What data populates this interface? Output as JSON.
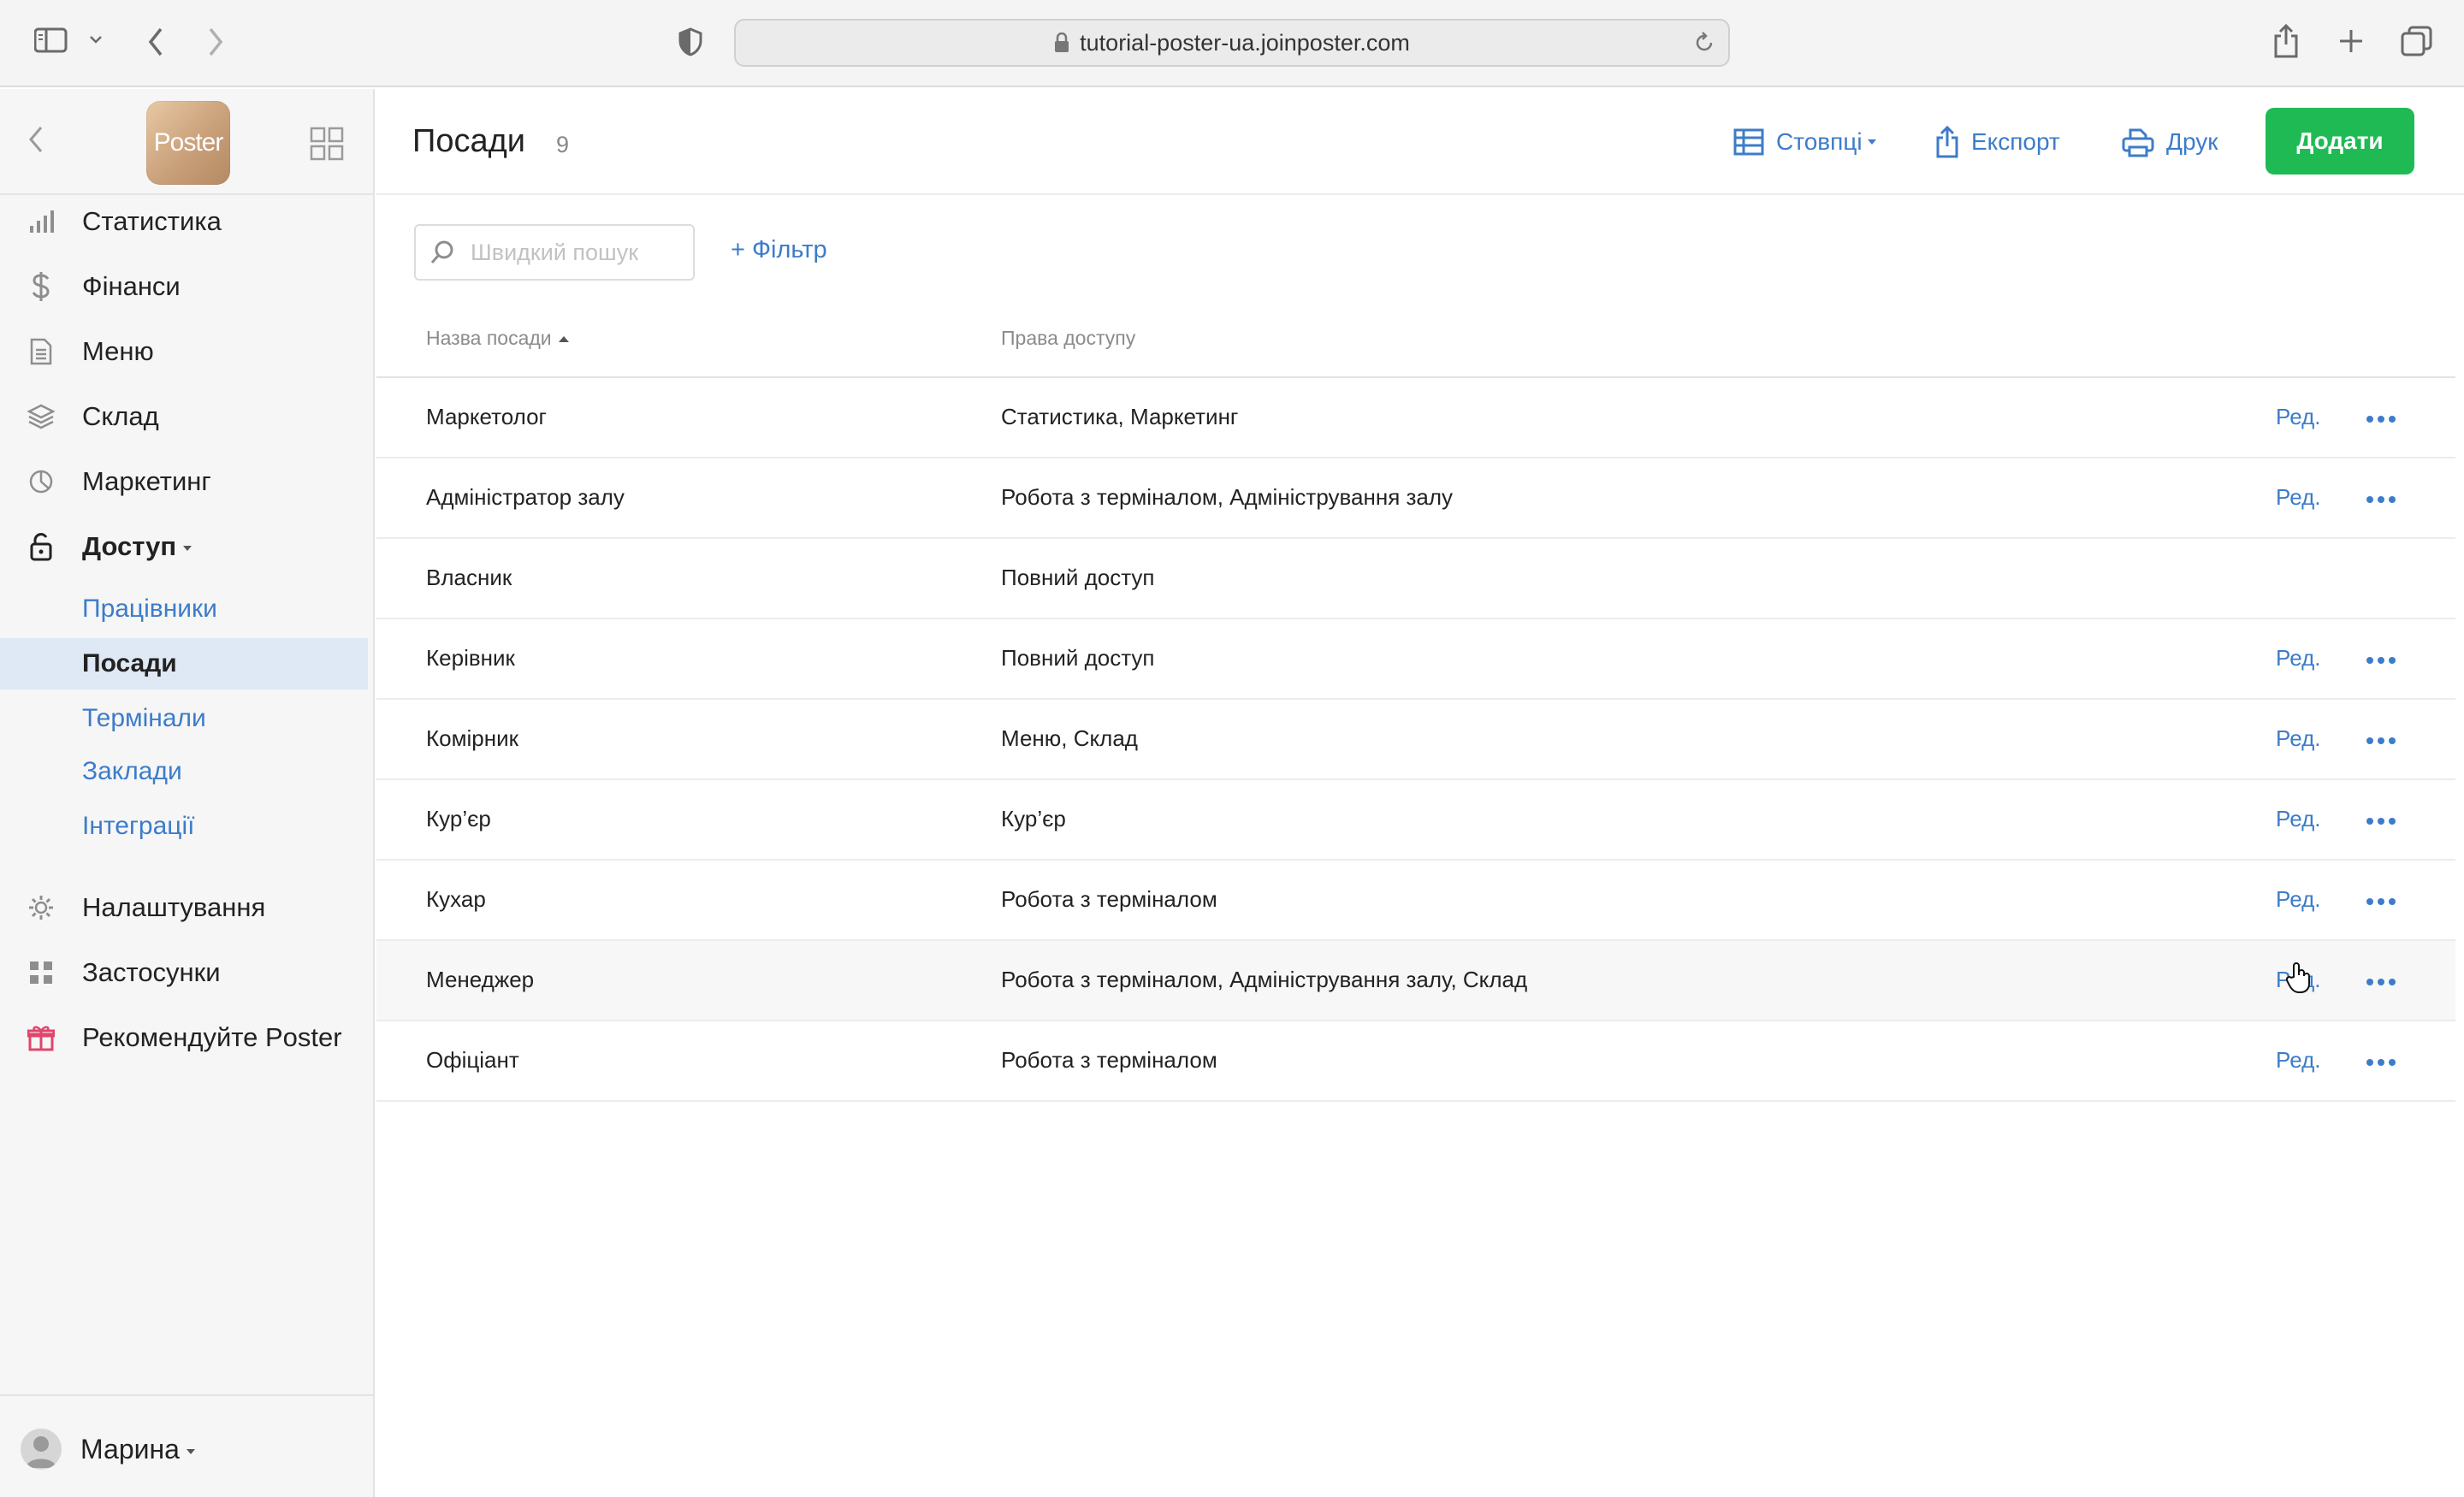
{
  "browser": {
    "url": "tutorial-poster-ua.joinposter.com"
  },
  "sidebar": {
    "logo_text": "Poster",
    "nav": [
      {
        "label": "Статистика",
        "icon": "bar-chart-icon"
      },
      {
        "label": "Фінанси",
        "icon": "dollar-icon"
      },
      {
        "label": "Меню",
        "icon": "document-icon"
      },
      {
        "label": "Склад",
        "icon": "layers-icon"
      },
      {
        "label": "Маркетинг",
        "icon": "pie-chart-icon"
      },
      {
        "label": "Доступ",
        "icon": "unlock-icon"
      }
    ],
    "sub": [
      {
        "label": "Працівники"
      },
      {
        "label": "Посади",
        "active": true
      },
      {
        "label": "Термінали"
      },
      {
        "label": "Заклади"
      },
      {
        "label": "Інтеграції"
      }
    ],
    "nav_bottom": [
      {
        "label": "Налаштування",
        "icon": "gear-icon"
      },
      {
        "label": "Застосунки",
        "icon": "apps-grid-icon"
      },
      {
        "label": "Рекомендуйте Poster",
        "icon": "gift-icon"
      }
    ],
    "user_name": "Марина"
  },
  "header": {
    "title": "Посади",
    "count": "9",
    "columns_label": "Стовпці",
    "export_label": "Експорт",
    "print_label": "Друк",
    "add_label": "Додати"
  },
  "toolbar": {
    "search_placeholder": "Швидкий пошук",
    "filter_label": "+ Фільтр"
  },
  "table": {
    "columns": [
      "Назва посади",
      "Права доступу"
    ],
    "edit_label": "Ред.",
    "rows": [
      {
        "name": "Маркетолог",
        "rights": "Статистика, Маркетинг",
        "editable": true
      },
      {
        "name": "Адміністратор залу",
        "rights": "Робота з терміналом, Адміністрування залу",
        "editable": true
      },
      {
        "name": "Власник",
        "rights": "Повний доступ",
        "editable": false
      },
      {
        "name": "Керівник",
        "rights": "Повний доступ",
        "editable": true
      },
      {
        "name": "Комірник",
        "rights": "Меню, Склад",
        "editable": true
      },
      {
        "name": "Кур’єр",
        "rights": "Кур’єр",
        "editable": true
      },
      {
        "name": "Кухар",
        "rights": "Робота з терміналом",
        "editable": true
      },
      {
        "name": "Менеджер",
        "rights": "Робота з терміналом, Адміністрування залу, Склад",
        "editable": true,
        "hover": true
      },
      {
        "name": "Офіціант",
        "rights": "Робота з терміналом",
        "editable": true
      }
    ]
  },
  "colors": {
    "accent": "#3d7cc9",
    "add_button": "#1fba54",
    "active_sub_bg": "#dfe9f5"
  }
}
